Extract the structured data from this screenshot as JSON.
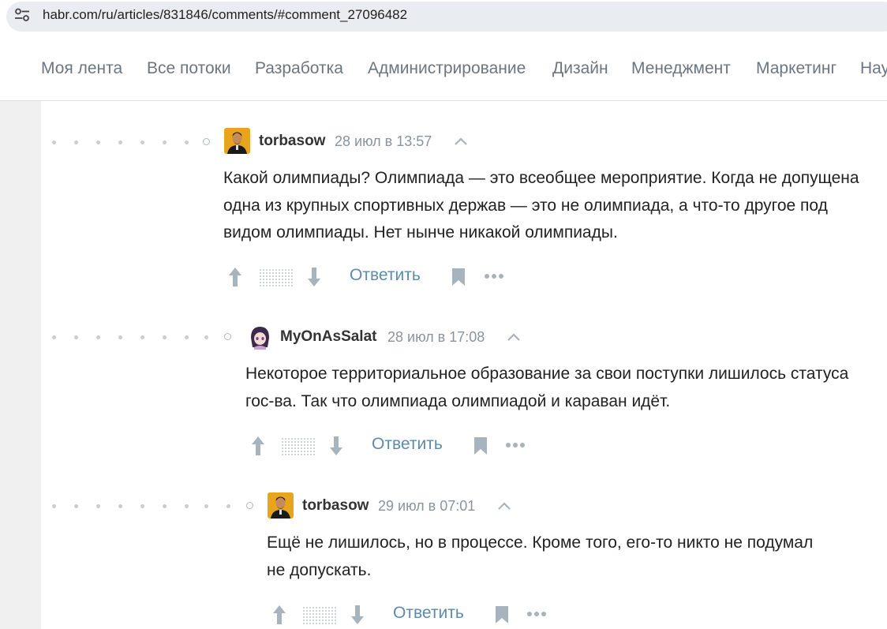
{
  "browser": {
    "url": "habr.com/ru/articles/831846/comments/#comment_27096482"
  },
  "nav": {
    "items": [
      "Моя лента",
      "Все потоки",
      "Разработка",
      "Администрирование",
      "Дизайн",
      "Менеджмент",
      "Маркетинг",
      "Нау"
    ]
  },
  "comments": [
    {
      "username": "torbasow",
      "timestamp": "28 июл в 13:57",
      "text": "Какой олимпиады? Олимпиада — это всеобщее мероприятие. Когда не допущена одна из крупных спортивных держав — это не олимпиада, а что-то другое под видом олимпиады. Нет нынче никакой олимпиады.",
      "reply_label": "Ответить"
    },
    {
      "username": "MyOnAsSalat",
      "timestamp": "28 июл в 17:08",
      "text": "Некоторое территориальное образование за свои поступки лишилось статуса гос-ва. Так что олимпиада олимпиадой и караван идёт.",
      "reply_label": "Ответить"
    },
    {
      "username": "torbasow",
      "timestamp": "29 июл в 07:01",
      "text": "Ещё не лишилось, но в процессе. Кроме того, его-то никто не подумал не допускать.",
      "reply_label": "Ответить"
    }
  ],
  "icons": {
    "site_settings": "site-settings-icon",
    "collapse": "chevron-up-icon",
    "upvote": "arrow-up-icon",
    "downvote": "arrow-down-icon",
    "bookmark": "bookmark-icon",
    "more": "more-dots-icon"
  },
  "colors": {
    "nav_text": "#6b7680",
    "reply_link": "#5e8aad",
    "timestamp": "#8a949c",
    "icon_gray": "#a7b3bd"
  }
}
